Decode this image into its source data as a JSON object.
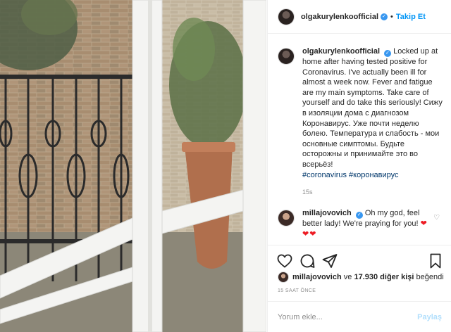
{
  "post": {
    "username": "olgakurylenkoofficial",
    "follow_label": "Takip Et",
    "caption": "Locked up at home after having tested positive for Coronavirus. I've actually been ill for almost a week now. Fever and fatigue are my main symptoms. Take care of yourself and do take this seriously! Сижу в изоляции дома с диагнозом Коронавирус. Уже почти неделю болею. Температура и слабость - мои основные симптомы. Будьте осторожны и принимайте это во всерьёз!",
    "hashtags": "#coronavirus #коронавирус",
    "caption_time": "15s"
  },
  "comment": {
    "username": "millajovovich",
    "text": "Oh my god, feel better lady! We're praying for you!",
    "hearts": "❤❤❤"
  },
  "actions": {
    "like_icon": "heart-outline-icon",
    "comment_icon": "comment-bubble-icon",
    "share_icon": "paper-plane-icon",
    "save_icon": "bookmark-icon"
  },
  "likes": {
    "user": "millajovovich",
    "connector": "ve",
    "count": "17.930",
    "rest": "diğer kişi",
    "verb": "beğendi"
  },
  "posted_ago": "15 SAAT ÖNCE",
  "add_comment": {
    "placeholder": "Yorum ekle...",
    "share_label": "Paylaş"
  },
  "colors": {
    "accent": "#0095f6",
    "verified": "#3897f0",
    "hashtag": "#00376b",
    "heart": "#ed1c24",
    "muted": "#8e8e8e"
  }
}
